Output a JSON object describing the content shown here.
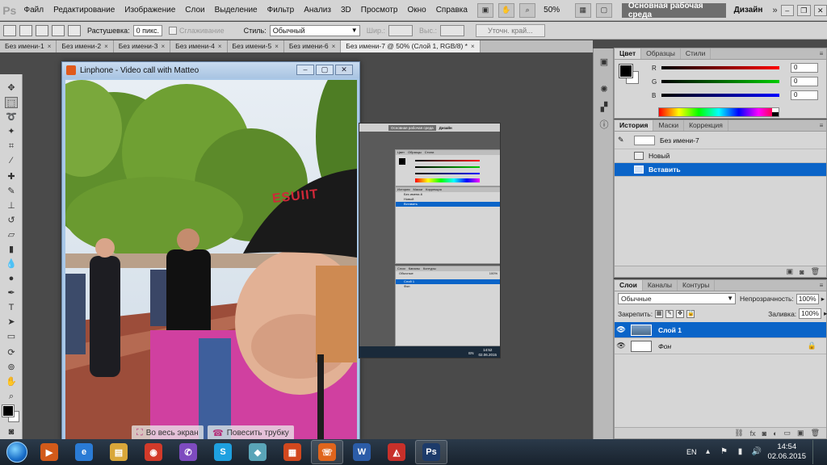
{
  "menubar": {
    "logo": "Ps",
    "items": [
      "Файл",
      "Редактирование",
      "Изображение",
      "Слои",
      "Выделение",
      "Фильтр",
      "Анализ",
      "3D",
      "Просмотр",
      "Окно",
      "Справка"
    ],
    "zoom": "50%",
    "workspace": "Основная рабочая среда",
    "design": "Дизайн",
    "more": "»"
  },
  "options": {
    "feather_label": "Растушевка:",
    "feather_value": "0 пикс.",
    "antialias_label": "Сглаживание",
    "style_label": "Стиль:",
    "style_value": "Обычный",
    "width_label": "Шир.:",
    "height_label": "Выс.:",
    "refine_label": "Уточн. край..."
  },
  "doc_tabs": [
    {
      "label": "Без имени-1"
    },
    {
      "label": "Без имени-2"
    },
    {
      "label": "Без имени-3"
    },
    {
      "label": "Без имени-4"
    },
    {
      "label": "Без имени-5"
    },
    {
      "label": "Без имени-6"
    },
    {
      "label": "Без имени-7 @ 50% (Слой 1, RGB/8) *"
    }
  ],
  "linphone": {
    "title": "Linphone - Video call with Matteo",
    "fullscreen_label": "Во весь экран",
    "hangup_label": "Повесить трубку",
    "cap_text": "ESUIIT"
  },
  "mini": {
    "workspace": "Основная рабочая среда",
    "design": "Дизайн",
    "color_tabs": [
      "Цвет",
      "Образцы",
      "Стили"
    ],
    "history_tabs": [
      "История",
      "Маски",
      "Коррекция"
    ],
    "history_doc": "Без имени-6",
    "history_items": [
      "Новый",
      "Вставить"
    ],
    "layers_tabs": [
      "Слои",
      "Каналы",
      "Контуры"
    ],
    "blend": "Обычные",
    "opacity": "100%",
    "layers": [
      "Слой 1",
      "Фон"
    ],
    "lang": "EN",
    "time": "14:52",
    "date": "02.06.2015"
  },
  "color_panel": {
    "tabs": [
      "Цвет",
      "Образцы",
      "Стили"
    ],
    "r_label": "R",
    "r_value": "0",
    "g_label": "G",
    "g_value": "0",
    "b_label": "B",
    "b_value": "0"
  },
  "history_panel": {
    "tabs": [
      "История",
      "Маски",
      "Коррекция"
    ],
    "doc": "Без имени-7",
    "items": [
      "Новый",
      "Вставить"
    ]
  },
  "layers_panel": {
    "tabs": [
      "Слои",
      "Каналы",
      "Контуры"
    ],
    "blend": "Обычные",
    "opacity_label": "Непрозрачность:",
    "opacity_value": "100%",
    "lock_label": "Закрепить:",
    "fill_label": "Заливка:",
    "fill_value": "100%",
    "layers": [
      "Слой 1",
      "Фон"
    ]
  },
  "taskbar": {
    "apps": [
      {
        "name": "media-player-icon",
        "glyph": "▶",
        "color": "#d25a1a"
      },
      {
        "name": "internet-explorer-icon",
        "glyph": "e",
        "color": "#2a7bd5"
      },
      {
        "name": "file-explorer-icon",
        "glyph": "▤",
        "color": "#d9a73a"
      },
      {
        "name": "chrome-icon",
        "glyph": "◉",
        "color": "#d23a2a"
      },
      {
        "name": "viber-icon",
        "glyph": "✆",
        "color": "#7d4bbf"
      },
      {
        "name": "skype-icon",
        "glyph": "S",
        "color": "#1ea0e0"
      },
      {
        "name": "app-generic-icon",
        "glyph": "◆",
        "color": "#5aa5b8"
      },
      {
        "name": "presentation-app-icon",
        "glyph": "▦",
        "color": "#d2481e"
      },
      {
        "name": "linphone-app-icon",
        "glyph": "☏",
        "color": "#e0651c"
      },
      {
        "name": "word-icon",
        "glyph": "W",
        "color": "#2b5ca8"
      },
      {
        "name": "sketchup-icon",
        "glyph": "◭",
        "color": "#c8302a"
      },
      {
        "name": "photoshop-icon",
        "glyph": "Ps",
        "color": "#1d3b6a"
      }
    ],
    "lang": "EN",
    "time": "14:54",
    "date": "02.06.2015"
  }
}
